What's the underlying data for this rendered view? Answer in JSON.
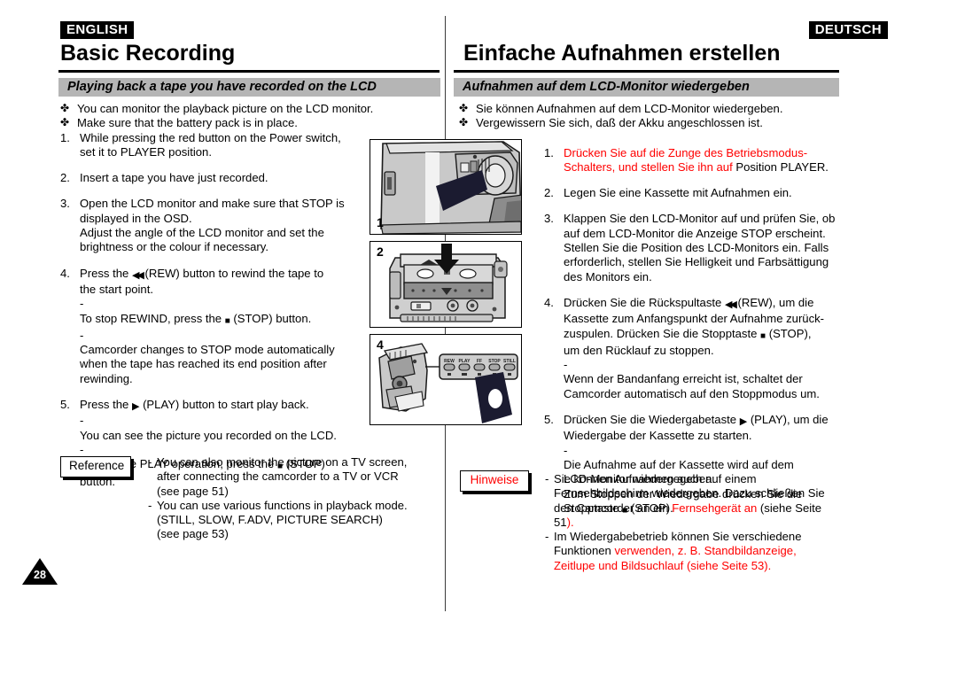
{
  "page": {
    "number": "28",
    "left_language_badge": "ENGLISH",
    "right_language_badge": "DEUTSCH",
    "left_title": "Basic Recording",
    "right_title": "Einfache Aufnahmen erstellen",
    "left_section": "Playing back a tape you have recorded on the LCD",
    "right_section": "Aufnahmen auf dem LCD-Monitor wiedergeben"
  },
  "english": {
    "bullets": [
      "You can monitor the playback picture on the LCD monitor.",
      "Make sure that the battery pack is in place."
    ],
    "steps": [
      {
        "num": "1.",
        "lines": [
          "While pressing the red button on the Power switch,",
          "set it to PLAYER position."
        ]
      },
      {
        "num": "2.",
        "lines": [
          "Insert a tape you have just recorded."
        ]
      },
      {
        "num": "3.",
        "lines": [
          "Open the LCD monitor and make sure that STOP is",
          "displayed in the OSD.",
          "Adjust the angle of the LCD monitor and set the",
          "brightness or the colour if necessary."
        ]
      }
    ],
    "step4": {
      "num": "4.",
      "line1_a": "Press the",
      "line1_b": "(REW) button to rewind the tape to",
      "line2": "the start point.",
      "sub1_a": "To stop REWIND, press the",
      "sub1_b": "(STOP) button.",
      "sub2": [
        "Camcorder changes to STOP mode automatically",
        "when the tape has reached its end position after",
        "rewinding."
      ]
    },
    "step5": {
      "num": "5.",
      "line1_a": "Press the",
      "line1_b": "(PLAY) button to start play back.",
      "sub1": "You can see the picture you recorded on the LCD.",
      "sub2_a": "To stop the PLAY operation, press the",
      "sub2_b": "(STOP)",
      "sub2_c": "button."
    },
    "reference_label": "Reference",
    "reference_items": [
      {
        "lines": [
          "You can also monitor the picture on a TV screen,",
          "after connecting the camcorder to a TV  or VCR",
          "(see page 51)"
        ]
      },
      {
        "lines": [
          "You can use various functions in playback mode.",
          "(STILL, SLOW, F.ADV, PICTURE SEARCH)",
          "(see page 53)"
        ]
      }
    ]
  },
  "german": {
    "bullets": [
      "Sie können Aufnahmen auf dem LCD-Monitor wiedergeben.",
      "Vergewissern Sie sich, daß der Akku angeschlossen ist."
    ],
    "step1": {
      "num": "1.",
      "red_line1": "Drücken Sie auf die Zunge des Betriebsmodus-",
      "red_line2": "Schalters, und stellen Sie ihn auf",
      "black_tail": "Position PLAYER."
    },
    "step2": {
      "num": "2.",
      "lines": [
        "Legen Sie eine Kassette mit Aufnahmen ein."
      ]
    },
    "step3": {
      "num": "3.",
      "lines": [
        "Klappen Sie den LCD-Monitor auf und prüfen Sie, ob",
        "auf dem LCD-Monitor die Anzeige STOP erscheint.",
        "Stellen Sie die Position des LCD-Monitors ein. Falls",
        "erforderlich, stellen Sie Helligkeit und Farbsättigung",
        "des Monitors ein."
      ]
    },
    "step4": {
      "num": "4.",
      "line1_a": "Drücken Sie die Rückspultaste",
      "line1_b": "(REW), um die",
      "line2": "Kassette zum Anfangspunkt der Aufnahme zurück-",
      "line3_a": "zuspulen. Drücken Sie die Stopptaste",
      "line3_b": "(STOP),",
      "line4": "um den Rücklauf zu stoppen.",
      "sub": [
        "Wenn der Bandanfang erreicht ist, schaltet der",
        "Camcorder automatisch auf den Stoppmodus um."
      ]
    },
    "step5": {
      "num": "5.",
      "line1_a": "Drücken Sie die Wiedergabetaste",
      "line1_b": "(PLAY), um die",
      "line2": "Wiedergabe der Kassette zu starten.",
      "sub": [
        "Die Aufnahme auf der Kassette wird auf dem",
        "LCD-Monitor wiedergegeben.",
        "Zum Stoppen der Wiedergabe drücken Sie die"
      ],
      "sub_last_a": "Stopptaste",
      "sub_last_b": "(STOP)."
    },
    "hinweise_label": "Hinweise",
    "hinweise_items": [
      {
        "line1": "Sie können Aufnahmen auch auf einem",
        "line2": "Fernsehbildschirm wiedergeben. Dazu schließen Sie",
        "line3_black": "den Camcorder an ein ",
        "line3_red": "Fernsehgerät an",
        "line3_tail": " (siehe Seite",
        "line4_black": "51",
        "line4_red": ")."
      },
      {
        "line1": "Im Wiedergabebetrieb können Sie verschiedene",
        "line2_black": "Funktionen ",
        "line2_red": "verwenden, z. B. Standbildanzeige,",
        "line3_red": "Zeitlupe und Bildsuchlauf (siehe Seite 53)."
      }
    ]
  },
  "figures": [
    {
      "number": "1",
      "caption": "camcorder power switch close-up with dark pointer overlay"
    },
    {
      "number": "2",
      "caption": "camcorder cassette compartment open with down arrow"
    },
    {
      "number": "4",
      "caption": "camcorder with playback button panel and pointing hand overlay",
      "buttons": [
        "REW",
        "PLAY",
        "FF",
        "STOP",
        "STILL"
      ]
    }
  ],
  "glyphs": {
    "club": "✤",
    "rew": "◀◀",
    "play": "▶",
    "stop": "■",
    "dash": "-"
  },
  "colors": {
    "accent_red": "#ff0000",
    "section_bar": "#b5b5b5",
    "badge_bg": "#000000",
    "text": "#000000"
  }
}
